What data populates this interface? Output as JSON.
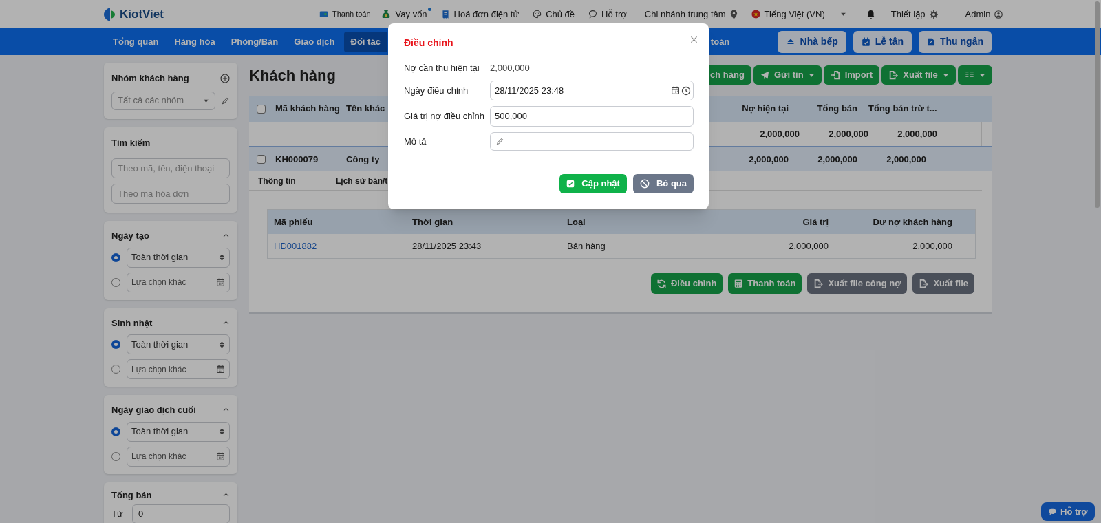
{
  "topbar": {
    "logo": "KiotViet",
    "links": [
      {
        "label": "Thanh toán",
        "badge": false
      },
      {
        "label": "Vay vốn",
        "badge": true
      },
      {
        "label": "Hoá đơn điện tử",
        "badge": false
      },
      {
        "label": "Chủ đề",
        "badge": false
      },
      {
        "label": "Hỗ trợ",
        "badge": false
      }
    ],
    "branch": "Chi nhánh trung tâm",
    "language": "Tiếng Việt (VN)",
    "settings": "Thiết lập",
    "user": "Admin"
  },
  "nav": {
    "items": [
      {
        "label": "Tổng quan",
        "selected": false
      },
      {
        "label": "Hàng hóa",
        "selected": false
      },
      {
        "label": "Phòng/Bàn",
        "selected": false
      },
      {
        "label": "Giao dịch",
        "selected": false
      },
      {
        "label": "Đối tác",
        "selected": true
      }
    ],
    "cut_item": "toán",
    "buttons": [
      "Nhà bếp",
      "Lễ tân",
      "Thu ngân"
    ]
  },
  "sidebar": {
    "panels": [
      {
        "kind": "group",
        "title": "Nhóm khách hàng",
        "placeholder": "Tất cả các nhóm"
      },
      {
        "kind": "search",
        "title": "Tìm kiếm",
        "placeholders": [
          "Theo mã, tên, điện thoại",
          "Theo mã hóa đơn"
        ]
      },
      {
        "kind": "date",
        "title": "Ngày tạo",
        "options": [
          {
            "label": "Toàn thời gian",
            "selected": true
          },
          {
            "label": "Lựa chọn khác",
            "selected": false
          }
        ]
      },
      {
        "kind": "date",
        "title": "Sinh nhật",
        "options": [
          {
            "label": "Toàn thời gian",
            "selected": true
          },
          {
            "label": "Lựa chọn khác",
            "selected": false
          }
        ]
      },
      {
        "kind": "date",
        "title": "Ngày giao dịch cuối",
        "options": [
          {
            "label": "Toàn thời gian",
            "selected": true
          },
          {
            "label": "Lựa chọn khác",
            "selected": false
          }
        ]
      },
      {
        "kind": "range",
        "title": "Tổng bán",
        "from_label": "Từ",
        "from_value": "0"
      }
    ]
  },
  "main": {
    "title": "Khách hàng",
    "actions": [
      {
        "kind": "cut",
        "label": "ch hàng",
        "dropdown": false
      },
      {
        "kind": "send",
        "label": "Gửi tin",
        "dropdown": true
      },
      {
        "kind": "import",
        "label": "Import",
        "dropdown": false
      },
      {
        "kind": "export",
        "label": "Xuất file",
        "dropdown": true
      },
      {
        "kind": "columns",
        "dropdown": true
      }
    ]
  },
  "table": {
    "header_checked": false,
    "columns": [
      "Mã khách hàng",
      "Tên khác",
      "Nợ hiện tại",
      "Tổng bán",
      "Tổng bán trừ t..."
    ],
    "summary": [
      "2,000,000",
      "2,000,000",
      "2,000,000"
    ],
    "rows": [
      {
        "selected": true,
        "checked": false,
        "code": "KH000079",
        "name": "Công ty",
        "values": [
          "2,000,000",
          "2,000,000",
          "2,000,000"
        ]
      }
    ]
  },
  "detail": {
    "tabs": [
      "Thông tin",
      "Lịch sử bán/t"
    ],
    "columns": [
      "Mã phiếu",
      "Thời gian",
      "Loại",
      "Giá trị",
      "Dư nợ khách hàng"
    ],
    "rows": [
      [
        "HD001882",
        "28/11/2025 23:43",
        "Bán hàng",
        "2,000,000",
        "2,000,000"
      ]
    ],
    "buttons": [
      {
        "kind": "adjust",
        "label": "Điều chỉnh"
      },
      {
        "kind": "pay",
        "label": "Thanh toán"
      },
      {
        "kind": "export",
        "label": "Xuất file công nợ"
      },
      {
        "kind": "export",
        "label": "Xuất file"
      }
    ]
  },
  "modal": {
    "title": "Điều chỉnh",
    "fields": [
      {
        "kind": "text",
        "label": "Nợ cần thu hiện tại",
        "value": "2,000,000"
      },
      {
        "kind": "datetime",
        "label": "Ngày điều chỉnh",
        "value": "28/11/2025 23:48"
      },
      {
        "kind": "input",
        "label": "Giá trị nợ điều chỉnh",
        "value": "500,000"
      },
      {
        "kind": "memo",
        "label": "Mô tả"
      }
    ],
    "buttons": [
      {
        "kind": "primary",
        "label": "Cập nhật"
      },
      {
        "kind": "secondary",
        "label": "Bỏ qua"
      }
    ]
  },
  "chat": {
    "label": "Hỗ trợ"
  }
}
